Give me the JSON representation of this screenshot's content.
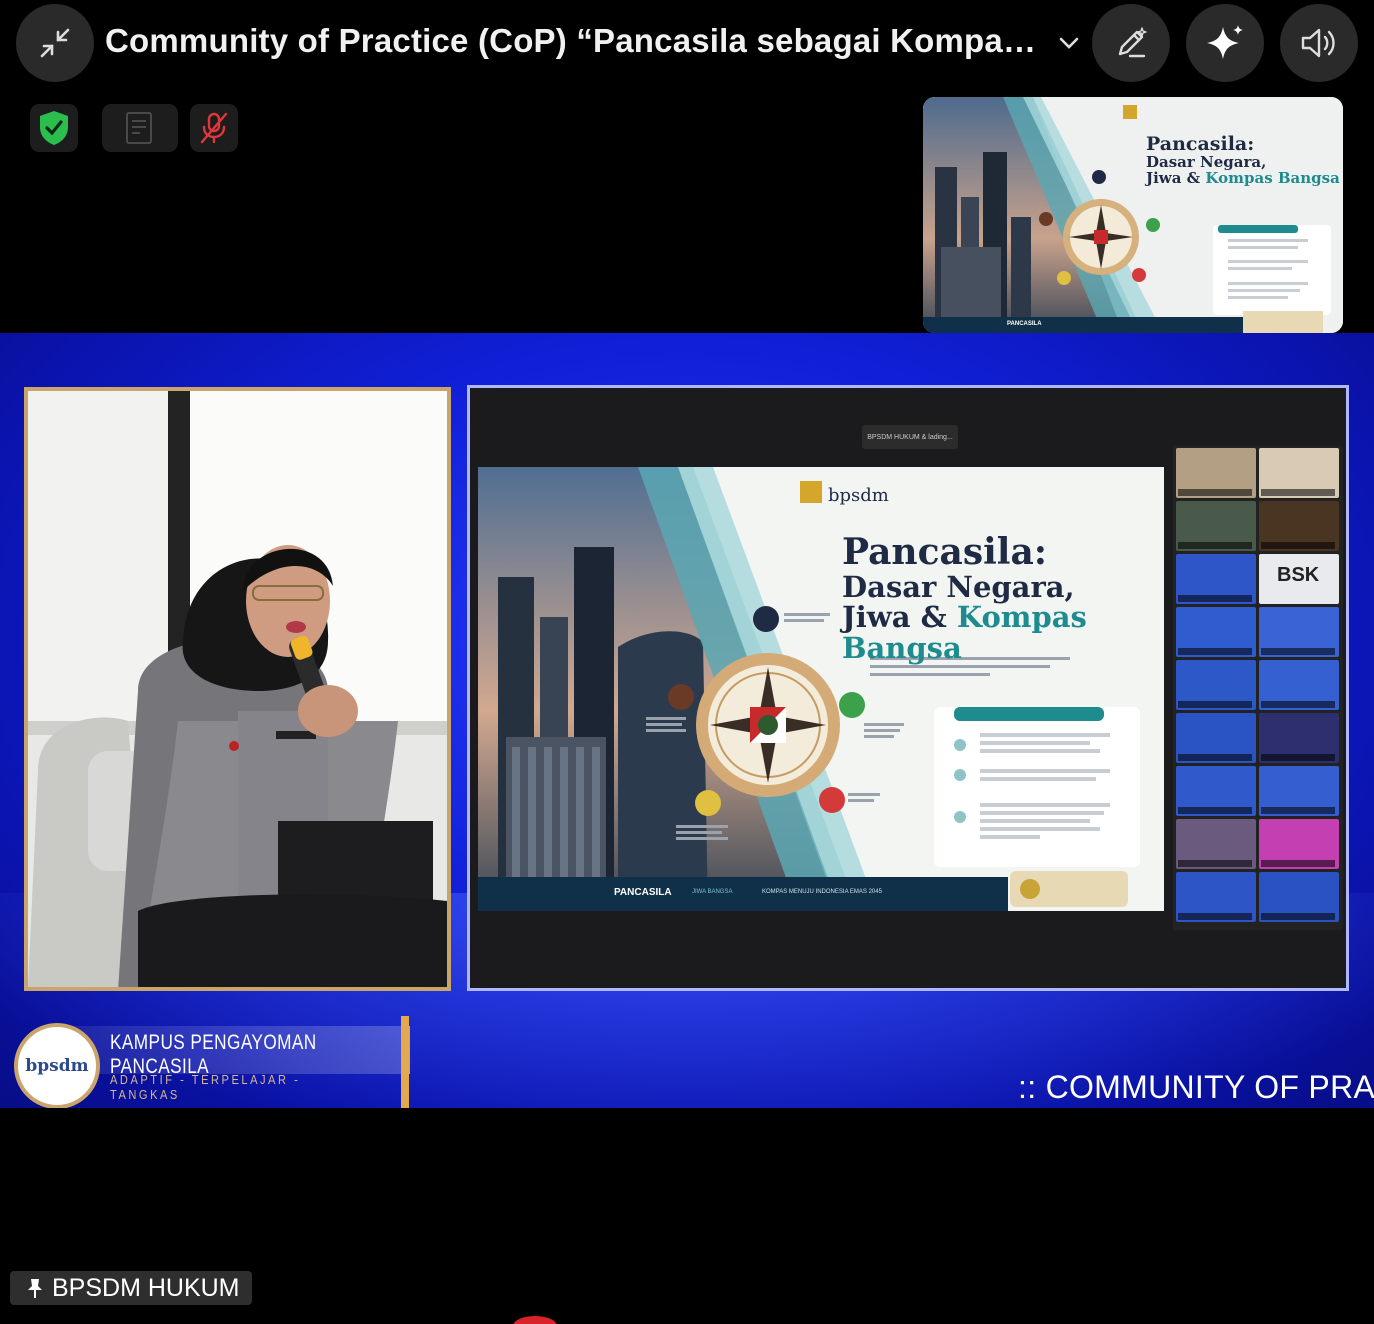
{
  "window": {
    "title": "Community of Practice (CoP) “Pancasila sebagai Kompas Bangsa”",
    "icons": {
      "minimize": "collapse-icon",
      "dropdown": "chevron-down-icon",
      "pen": "draw-icon",
      "ai": "sparkle-icon",
      "audio": "speaker-icon"
    }
  },
  "status": {
    "icons": [
      "shield-check-icon",
      "document-icon",
      "mic-off-icon"
    ],
    "colors": {
      "shield": "#2bbd4e",
      "mic_off": "#e0373a"
    }
  },
  "thumbnail": {
    "title_line1": "Pancasila:",
    "title_line2": "Dasar Negara,",
    "title_line3a": "Jiwa & ",
    "title_line3b": "Kompas Bangsa",
    "footer": "PANCASILA"
  },
  "broadcast": {
    "share_chip": "BPSDM HUKUM & lading...",
    "slide": {
      "title_line1": "Pancasila:",
      "title_line2": "Dasar Negara,",
      "title_line3a": "Jiwa & ",
      "title_line3b": "Kompas Bangsa",
      "footer_main": "PANCASILA",
      "footer_sub1": "JIWA BANGSA",
      "footer_sub2": "KOMPAS MENUJU INDONESIA EMAS 2045"
    },
    "gallery_names": [
      "",
      "",
      "",
      "",
      "",
      "BSK",
      "",
      "",
      "",
      "",
      "",
      "",
      "",
      "",
      "",
      "",
      "",
      ""
    ],
    "brand_logo_text": "bpsdm",
    "brand_name": "KAMPUS PENGAYOMAN PANCASILA",
    "brand_tagline": "ADAPTIF - TERPELAJAR - TANGKAS",
    "ticker": ":: COMMUNITY OF PRAC",
    "colors": {
      "accent": "#c9a56b",
      "teal": "#1e8b8f",
      "frame_blue": "#1020d8"
    }
  },
  "channel": {
    "icon": "pin-icon",
    "name": "BPSDM HUKUM"
  }
}
